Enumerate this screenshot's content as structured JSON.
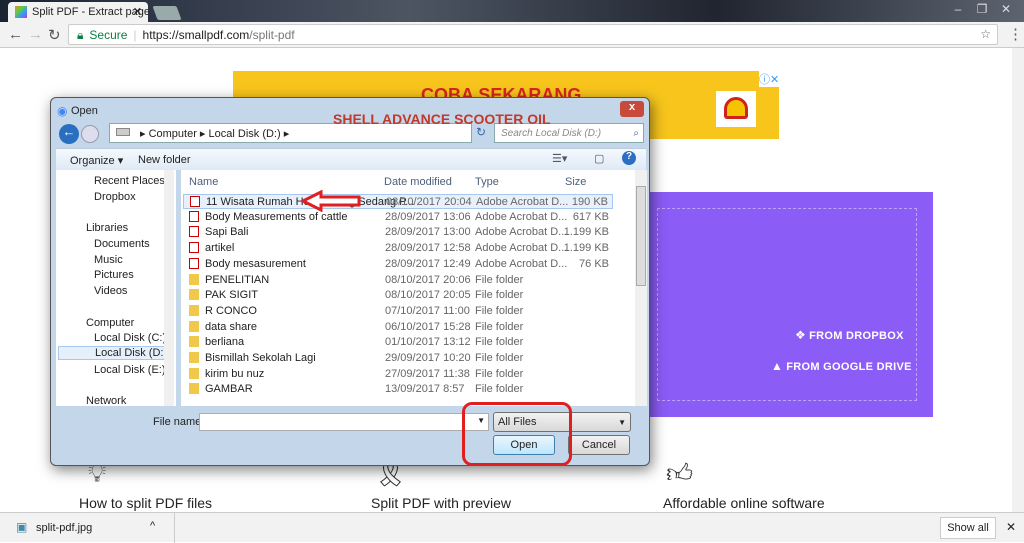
{
  "browser": {
    "tab_title": "Split PDF - Extract pages",
    "url_secure": "Secure",
    "url_host": "https://smallpdf.com",
    "url_path": "/split-pdf"
  },
  "ad": {
    "headline": "COBA SEKARANG",
    "subline": "SHELL ADVANCE SCOOTER OIL"
  },
  "upload": {
    "dropbox": "FROM DROPBOX",
    "gdrive": "FROM GOOGLE DRIVE"
  },
  "features": [
    "How to split PDF files",
    "Split PDF with preview",
    "Affordable online software"
  ],
  "download": {
    "file": "split-pdf.jpg",
    "show_all": "Show all"
  },
  "dialog": {
    "title": "Open",
    "breadcrumb": [
      "Computer",
      "Local Disk (D:)"
    ],
    "search_placeholder": "Search Local Disk (D:)",
    "organize": "Organize ▾",
    "new_folder": "New folder",
    "nav": [
      "Recent Places",
      "Dropbox",
      "Libraries",
      "Documents",
      "Music",
      "Pictures",
      "Videos",
      "Computer",
      "Local Disk (C:)",
      "Local Disk (D:)",
      "Local Disk (E:)",
      "Network"
    ],
    "columns": [
      "Name",
      "Date modified",
      "Type",
      "Size"
    ],
    "files": [
      {
        "name": "11 Wisata Rumah Hobbit Yang Sedang P...",
        "date": "08/10/2017 20:04",
        "type": "Adobe Acrobat D...",
        "size": "190 KB",
        "kind": "pdf"
      },
      {
        "name": "Body Measurements of cattle",
        "date": "28/09/2017 13:06",
        "type": "Adobe Acrobat D...",
        "size": "617 KB",
        "kind": "pdf"
      },
      {
        "name": "Sapi Bali",
        "date": "28/09/2017 13:00",
        "type": "Adobe Acrobat D...",
        "size": "1.199 KB",
        "kind": "pdf"
      },
      {
        "name": "artikel",
        "date": "28/09/2017 12:58",
        "type": "Adobe Acrobat D...",
        "size": "1.199 KB",
        "kind": "pdf"
      },
      {
        "name": "Body mesasurement",
        "date": "28/09/2017 12:49",
        "type": "Adobe Acrobat D...",
        "size": "76 KB",
        "kind": "pdf"
      },
      {
        "name": "PENELITIAN",
        "date": "08/10/2017 20:06",
        "type": "File folder",
        "size": "",
        "kind": "folder"
      },
      {
        "name": "PAK SIGIT",
        "date": "08/10/2017 20:05",
        "type": "File folder",
        "size": "",
        "kind": "folder"
      },
      {
        "name": "R CONCO",
        "date": "07/10/2017 11:00",
        "type": "File folder",
        "size": "",
        "kind": "folder"
      },
      {
        "name": "data share",
        "date": "06/10/2017 15:28",
        "type": "File folder",
        "size": "",
        "kind": "folder"
      },
      {
        "name": "berliana",
        "date": "01/10/2017 13:12",
        "type": "File folder",
        "size": "",
        "kind": "folder"
      },
      {
        "name": "Bismillah Sekolah Lagi",
        "date": "29/09/2017 10:20",
        "type": "File folder",
        "size": "",
        "kind": "folder"
      },
      {
        "name": "kirim bu nuz",
        "date": "27/09/2017 11:38",
        "type": "File folder",
        "size": "",
        "kind": "folder"
      },
      {
        "name": "GAMBAR",
        "date": "13/09/2017 8:57",
        "type": "File folder",
        "size": "",
        "kind": "folder"
      }
    ],
    "file_name_label": "File name:",
    "file_name_value": "",
    "filter": "All Files",
    "open": "Open",
    "cancel": "Cancel"
  },
  "colors": {
    "purple": "#8b5cf6",
    "highlight": "#e02020"
  }
}
